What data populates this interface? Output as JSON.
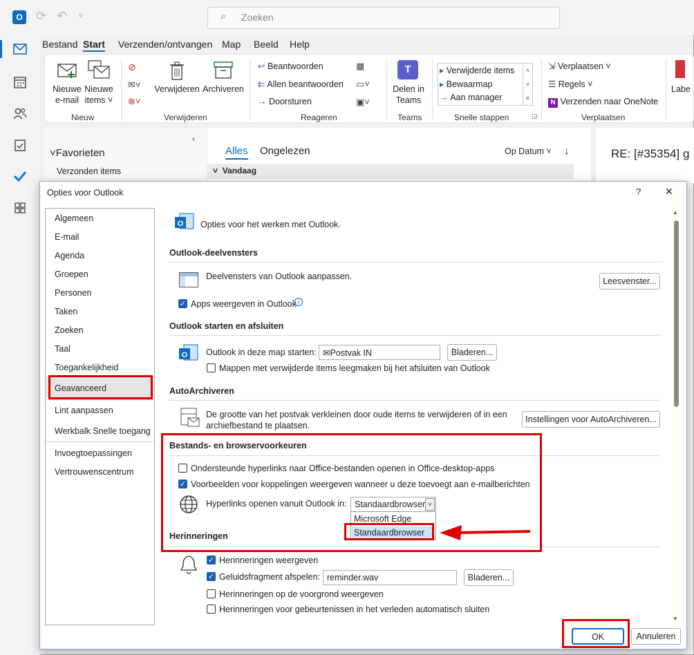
{
  "app": {
    "search_placeholder": "Zoeken"
  },
  "menubar": [
    "Bestand",
    "Start",
    "Verzenden/ontvangen",
    "Map",
    "Beeld",
    "Help"
  ],
  "ribbon": {
    "new_mail": "Nieuwe\ne-mail",
    "new_items": "Nieuwe\nitems ˅",
    "group_new": "Nieuw",
    "delete": "Verwijderen",
    "archive": "Archiveren",
    "group_delete": "Verwijderen",
    "reply": "Beantwoorden",
    "reply_all": "Allen beantwoorden",
    "forward": "Doorsturen",
    "group_respond": "Reageren",
    "share_teams": "Delen in\nTeams",
    "group_teams": "Teams",
    "quick_steps": [
      "Verwijderde items",
      "Bewaarmap",
      "Aan manager"
    ],
    "group_quick": "Snelle stappen",
    "move": "Verplaatsen ˅",
    "rules": "Regels ˅",
    "onenote": "Verzenden naar OneNote",
    "group_move": "Verplaatsen",
    "labels": "Labe"
  },
  "folders": {
    "favorites": "Favorieten",
    "sent": "Verzonden items"
  },
  "maillist": {
    "tab_all": "Alles",
    "tab_unread": "Ongelezen",
    "sort": "Op Datum",
    "group_today": "Vandaag"
  },
  "readpane": {
    "subject": "RE: [#35354] g"
  },
  "dialog": {
    "title": "Opties voor Outlook",
    "help": "?",
    "close": "✕",
    "nav": [
      "Algemeen",
      "E-mail",
      "Agenda",
      "Groepen",
      "Personen",
      "Taken",
      "Zoeken",
      "Taal",
      "Toegankelijkheid",
      "Geavanceerd",
      "Lint aanpassen",
      "Werkbalk Snelle toegang",
      "Invoegtoepassingen",
      "Vertrouwenscentrum"
    ],
    "intro": "Opties voor het werken met Outlook.",
    "sections": {
      "panes": "Outlook-deelvensters",
      "startstop": "Outlook starten en afsluiten",
      "autoarchive": "AutoArchiveren",
      "filebrowser": "Bestands- en browservoorkeuren",
      "reminders": "Herinneringen"
    },
    "panes_text": "Deelvensters van Outlook aanpassen.",
    "panes_button": "Leesvenster...",
    "apps_show": "Apps weergeven in Outlook",
    "start_in_folder": "Outlook in deze map starten:",
    "start_folder_value": "Postvak IN",
    "browse": "Bladeren...",
    "empty_deleted": "Mappen met verwijderde items leegmaken bij het afsluiten van Outlook",
    "autoarchive_text1": "De grootte van het postvak verkleinen door oude items te verwijderen of in een",
    "autoarchive_text2": "archiefbestand te plaatsen.",
    "autoarchive_button": "Instellingen voor AutoArchiveren...",
    "open_in_desktop": "Ondersteunde hyperlinks naar Office-bestanden openen in Office-desktop-apps",
    "link_previews": "Voorbeelden voor koppelingen weergeven wanneer u deze toevoegt aan e-mailberichten",
    "hyperlinks_label": "Hyperlinks openen vanuit Outlook in:",
    "hyperlinks_value": "Standaardbrowser",
    "dropdown_options": [
      "Microsoft Edge",
      "Standaardbrowser"
    ],
    "show_reminders": "Herinneringen weergeven",
    "play_sound": "Geluidsfragment afspelen:",
    "sound_file": "reminder.wav",
    "browse2": "Bladeren...",
    "foreground": "Herinneringen op de voorgrond weergeven",
    "auto_close": "Herinneringen voor gebeurtenissen in het verleden automatisch sluiten",
    "ok": "OK",
    "cancel": "Annuleren"
  },
  "colors": {
    "accent": "#0f6cbd",
    "highlight": "#e00000"
  }
}
